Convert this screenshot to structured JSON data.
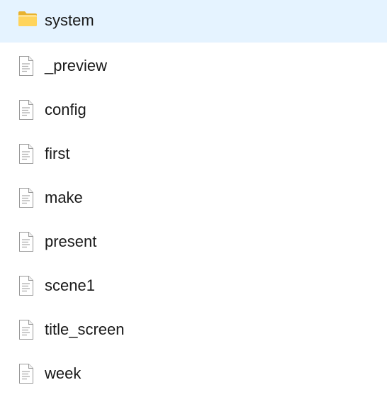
{
  "items": [
    {
      "name": "system",
      "icon": "folder-icon",
      "folder_color": "#f7c948"
    },
    {
      "name": "_preview",
      "icon": "document-icon"
    },
    {
      "name": "config",
      "icon": "document-icon"
    },
    {
      "name": "first",
      "icon": "document-icon"
    },
    {
      "name": "make",
      "icon": "document-icon"
    },
    {
      "name": "present",
      "icon": "document-icon"
    },
    {
      "name": "scene1",
      "icon": "document-icon"
    },
    {
      "name": "title_screen",
      "icon": "document-icon"
    },
    {
      "name": "week",
      "icon": "document-icon"
    }
  ]
}
